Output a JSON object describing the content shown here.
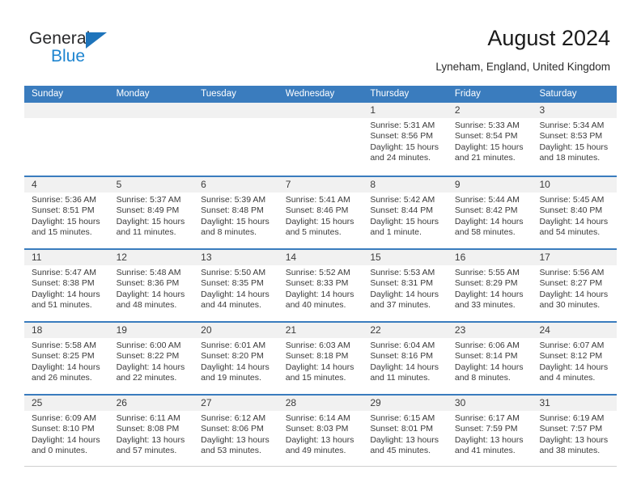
{
  "brand": {
    "name_part1": "General",
    "name_part2": "Blue",
    "triangle_color": "#1e74bb",
    "blue_color": "#1e85d0"
  },
  "header": {
    "title": "August 2024",
    "subtitle": "Lyneham, England, United Kingdom"
  },
  "theme": {
    "header_blue": "#3a7cbe",
    "daynum_bg": "#f1f1f1",
    "text": "#3a3a3a"
  },
  "weekdays": [
    "Sunday",
    "Monday",
    "Tuesday",
    "Wednesday",
    "Thursday",
    "Friday",
    "Saturday"
  ],
  "weeks": [
    [
      {
        "day": "",
        "empty": true
      },
      {
        "day": "",
        "empty": true
      },
      {
        "day": "",
        "empty": true
      },
      {
        "day": "",
        "empty": true
      },
      {
        "day": "1",
        "sunrise": "Sunrise: 5:31 AM",
        "sunset": "Sunset: 8:56 PM",
        "daylight_1": "Daylight: 15 hours",
        "daylight_2": "and 24 minutes."
      },
      {
        "day": "2",
        "sunrise": "Sunrise: 5:33 AM",
        "sunset": "Sunset: 8:54 PM",
        "daylight_1": "Daylight: 15 hours",
        "daylight_2": "and 21 minutes."
      },
      {
        "day": "3",
        "sunrise": "Sunrise: 5:34 AM",
        "sunset": "Sunset: 8:53 PM",
        "daylight_1": "Daylight: 15 hours",
        "daylight_2": "and 18 minutes."
      }
    ],
    [
      {
        "day": "4",
        "sunrise": "Sunrise: 5:36 AM",
        "sunset": "Sunset: 8:51 PM",
        "daylight_1": "Daylight: 15 hours",
        "daylight_2": "and 15 minutes."
      },
      {
        "day": "5",
        "sunrise": "Sunrise: 5:37 AM",
        "sunset": "Sunset: 8:49 PM",
        "daylight_1": "Daylight: 15 hours",
        "daylight_2": "and 11 minutes."
      },
      {
        "day": "6",
        "sunrise": "Sunrise: 5:39 AM",
        "sunset": "Sunset: 8:48 PM",
        "daylight_1": "Daylight: 15 hours",
        "daylight_2": "and 8 minutes."
      },
      {
        "day": "7",
        "sunrise": "Sunrise: 5:41 AM",
        "sunset": "Sunset: 8:46 PM",
        "daylight_1": "Daylight: 15 hours",
        "daylight_2": "and 5 minutes."
      },
      {
        "day": "8",
        "sunrise": "Sunrise: 5:42 AM",
        "sunset": "Sunset: 8:44 PM",
        "daylight_1": "Daylight: 15 hours",
        "daylight_2": "and 1 minute."
      },
      {
        "day": "9",
        "sunrise": "Sunrise: 5:44 AM",
        "sunset": "Sunset: 8:42 PM",
        "daylight_1": "Daylight: 14 hours",
        "daylight_2": "and 58 minutes."
      },
      {
        "day": "10",
        "sunrise": "Sunrise: 5:45 AM",
        "sunset": "Sunset: 8:40 PM",
        "daylight_1": "Daylight: 14 hours",
        "daylight_2": "and 54 minutes."
      }
    ],
    [
      {
        "day": "11",
        "sunrise": "Sunrise: 5:47 AM",
        "sunset": "Sunset: 8:38 PM",
        "daylight_1": "Daylight: 14 hours",
        "daylight_2": "and 51 minutes."
      },
      {
        "day": "12",
        "sunrise": "Sunrise: 5:48 AM",
        "sunset": "Sunset: 8:36 PM",
        "daylight_1": "Daylight: 14 hours",
        "daylight_2": "and 48 minutes."
      },
      {
        "day": "13",
        "sunrise": "Sunrise: 5:50 AM",
        "sunset": "Sunset: 8:35 PM",
        "daylight_1": "Daylight: 14 hours",
        "daylight_2": "and 44 minutes."
      },
      {
        "day": "14",
        "sunrise": "Sunrise: 5:52 AM",
        "sunset": "Sunset: 8:33 PM",
        "daylight_1": "Daylight: 14 hours",
        "daylight_2": "and 40 minutes."
      },
      {
        "day": "15",
        "sunrise": "Sunrise: 5:53 AM",
        "sunset": "Sunset: 8:31 PM",
        "daylight_1": "Daylight: 14 hours",
        "daylight_2": "and 37 minutes."
      },
      {
        "day": "16",
        "sunrise": "Sunrise: 5:55 AM",
        "sunset": "Sunset: 8:29 PM",
        "daylight_1": "Daylight: 14 hours",
        "daylight_2": "and 33 minutes."
      },
      {
        "day": "17",
        "sunrise": "Sunrise: 5:56 AM",
        "sunset": "Sunset: 8:27 PM",
        "daylight_1": "Daylight: 14 hours",
        "daylight_2": "and 30 minutes."
      }
    ],
    [
      {
        "day": "18",
        "sunrise": "Sunrise: 5:58 AM",
        "sunset": "Sunset: 8:25 PM",
        "daylight_1": "Daylight: 14 hours",
        "daylight_2": "and 26 minutes."
      },
      {
        "day": "19",
        "sunrise": "Sunrise: 6:00 AM",
        "sunset": "Sunset: 8:22 PM",
        "daylight_1": "Daylight: 14 hours",
        "daylight_2": "and 22 minutes."
      },
      {
        "day": "20",
        "sunrise": "Sunrise: 6:01 AM",
        "sunset": "Sunset: 8:20 PM",
        "daylight_1": "Daylight: 14 hours",
        "daylight_2": "and 19 minutes."
      },
      {
        "day": "21",
        "sunrise": "Sunrise: 6:03 AM",
        "sunset": "Sunset: 8:18 PM",
        "daylight_1": "Daylight: 14 hours",
        "daylight_2": "and 15 minutes."
      },
      {
        "day": "22",
        "sunrise": "Sunrise: 6:04 AM",
        "sunset": "Sunset: 8:16 PM",
        "daylight_1": "Daylight: 14 hours",
        "daylight_2": "and 11 minutes."
      },
      {
        "day": "23",
        "sunrise": "Sunrise: 6:06 AM",
        "sunset": "Sunset: 8:14 PM",
        "daylight_1": "Daylight: 14 hours",
        "daylight_2": "and 8 minutes."
      },
      {
        "day": "24",
        "sunrise": "Sunrise: 6:07 AM",
        "sunset": "Sunset: 8:12 PM",
        "daylight_1": "Daylight: 14 hours",
        "daylight_2": "and 4 minutes."
      }
    ],
    [
      {
        "day": "25",
        "sunrise": "Sunrise: 6:09 AM",
        "sunset": "Sunset: 8:10 PM",
        "daylight_1": "Daylight: 14 hours",
        "daylight_2": "and 0 minutes."
      },
      {
        "day": "26",
        "sunrise": "Sunrise: 6:11 AM",
        "sunset": "Sunset: 8:08 PM",
        "daylight_1": "Daylight: 13 hours",
        "daylight_2": "and 57 minutes."
      },
      {
        "day": "27",
        "sunrise": "Sunrise: 6:12 AM",
        "sunset": "Sunset: 8:06 PM",
        "daylight_1": "Daylight: 13 hours",
        "daylight_2": "and 53 minutes."
      },
      {
        "day": "28",
        "sunrise": "Sunrise: 6:14 AM",
        "sunset": "Sunset: 8:03 PM",
        "daylight_1": "Daylight: 13 hours",
        "daylight_2": "and 49 minutes."
      },
      {
        "day": "29",
        "sunrise": "Sunrise: 6:15 AM",
        "sunset": "Sunset: 8:01 PM",
        "daylight_1": "Daylight: 13 hours",
        "daylight_2": "and 45 minutes."
      },
      {
        "day": "30",
        "sunrise": "Sunrise: 6:17 AM",
        "sunset": "Sunset: 7:59 PM",
        "daylight_1": "Daylight: 13 hours",
        "daylight_2": "and 41 minutes."
      },
      {
        "day": "31",
        "sunrise": "Sunrise: 6:19 AM",
        "sunset": "Sunset: 7:57 PM",
        "daylight_1": "Daylight: 13 hours",
        "daylight_2": "and 38 minutes."
      }
    ]
  ]
}
